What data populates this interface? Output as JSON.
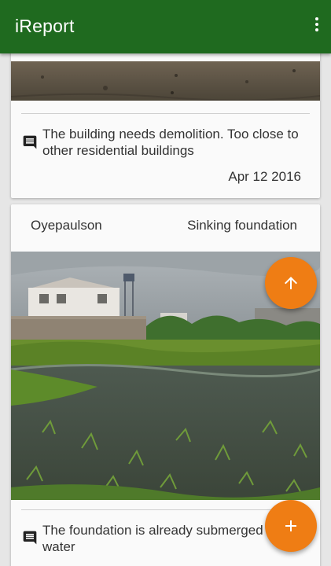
{
  "app": {
    "title": "iReport"
  },
  "colors": {
    "appbar": "#1f6a1f",
    "fab": "#ef7d14",
    "background": "#e6e6e6"
  },
  "icons": {
    "menu": "more-vert-icon",
    "comment": "comment-icon",
    "scroll_top": "arrow-up-icon",
    "add": "plus-icon"
  },
  "reports": [
    {
      "comment": "The building needs demolition. Too close to other residential buildings",
      "date": "Apr 12 2016"
    },
    {
      "user": "Oyepaulson",
      "category": "Sinking foundation",
      "comment": "The foundation is already submerged in water"
    }
  ]
}
